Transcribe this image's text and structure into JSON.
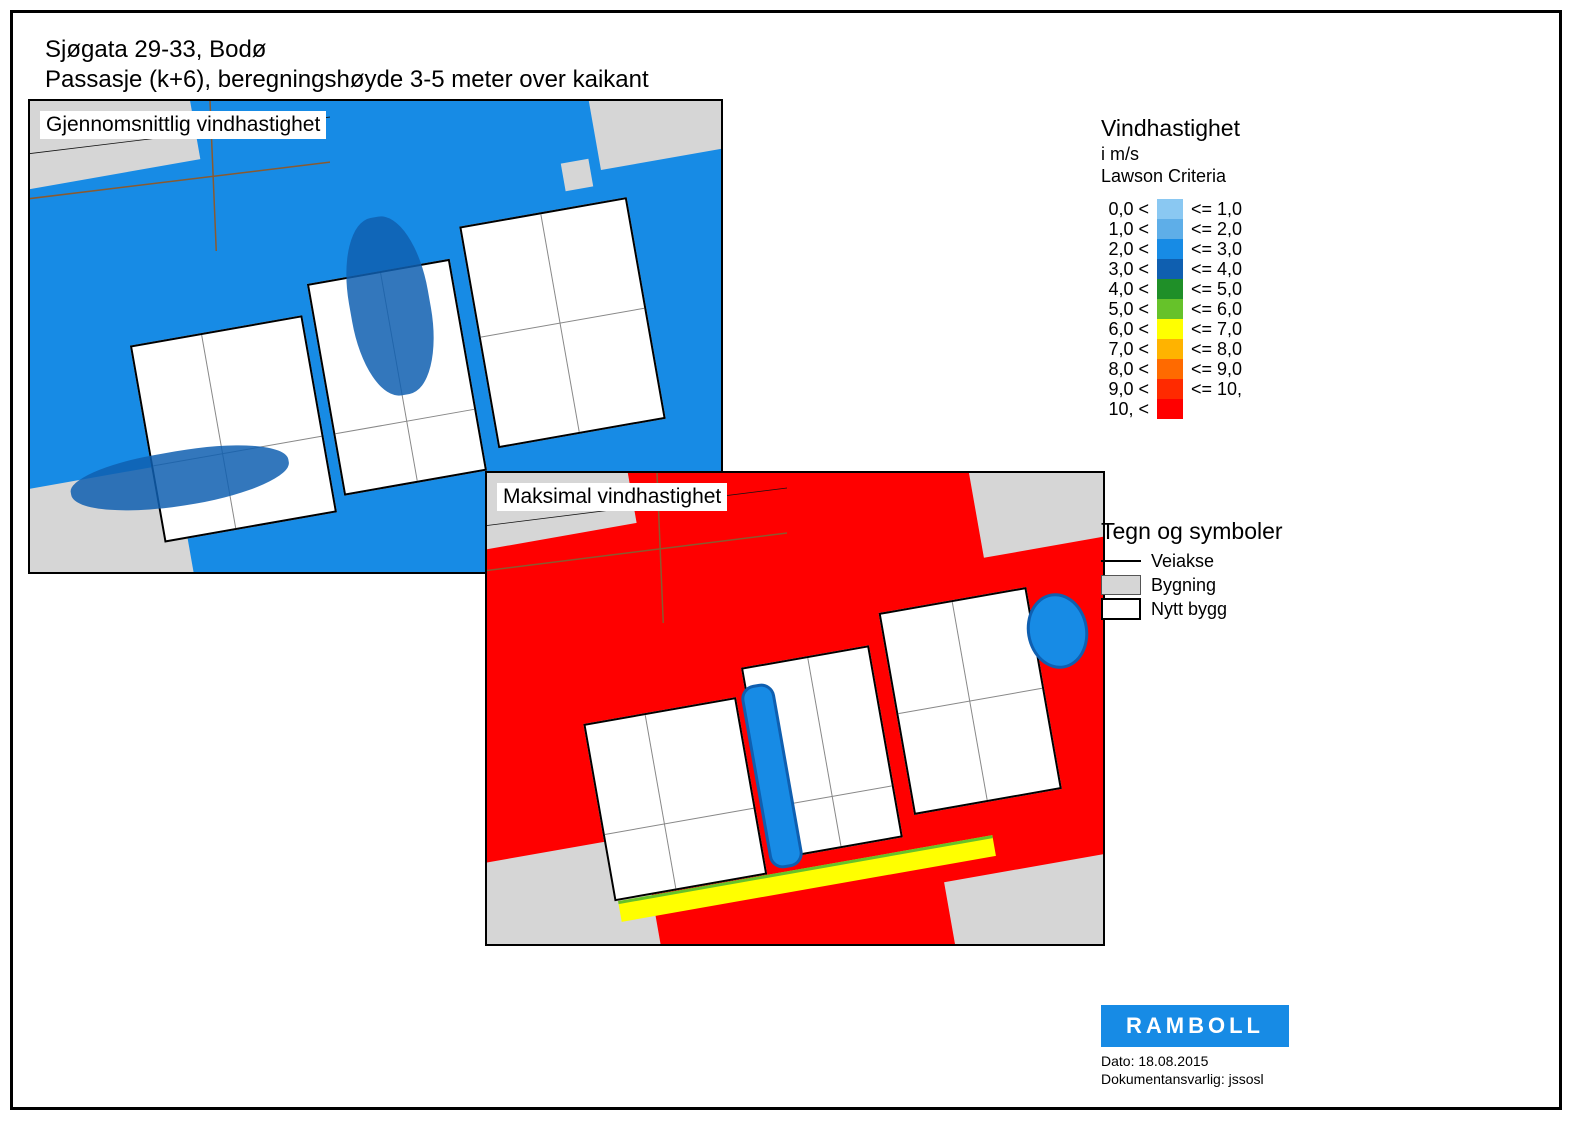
{
  "title": {
    "line1": "Sjøgata 29-33, Bodø",
    "line2": "Passasje (k+6), beregningshøyde 3-5 meter over kaikant"
  },
  "panels": {
    "avg_label": "Gjennomsnittlig vindhastighet",
    "max_label": "Maksimal vindhastighet"
  },
  "legend": {
    "title": "Vindhastighet",
    "subtitle": "i m/s\nLawson Criteria",
    "rows": [
      {
        "low": "0,0 <",
        "color": "#8ac8f2",
        "high": "<= 1,0"
      },
      {
        "low": "1,0 <",
        "color": "#5eaee8",
        "high": "<= 2,0"
      },
      {
        "low": "2,0 <",
        "color": "#178be5",
        "high": "<= 3,0"
      },
      {
        "low": "3,0 <",
        "color": "#0f5fb0",
        "high": "<= 4,0"
      },
      {
        "low": "4,0 <",
        "color": "#1f8f28",
        "high": "<= 5,0"
      },
      {
        "low": "5,0 <",
        "color": "#66c22a",
        "high": "<= 6,0"
      },
      {
        "low": "6,0 <",
        "color": "#ffff00",
        "high": "<= 7,0"
      },
      {
        "low": "7,0 <",
        "color": "#ffb300",
        "high": "<= 8,0"
      },
      {
        "low": "8,0 <",
        "color": "#ff6a00",
        "high": "<= 9,0"
      },
      {
        "low": "9,0 <",
        "color": "#ff2a00",
        "high": "<= 10,"
      },
      {
        "low": "10, <",
        "color": "#ff0000",
        "high": ""
      }
    ]
  },
  "symbols": {
    "title": "Tegn og symboler",
    "items": [
      {
        "kind": "line",
        "label": "Veiakse"
      },
      {
        "kind": "grey",
        "label": "Bygning"
      },
      {
        "kind": "white",
        "label": "Nytt bygg"
      }
    ]
  },
  "logo_text": "RAMBOLL",
  "meta": {
    "date_label": "Dato: ",
    "date_value": "18.08.2015",
    "owner_label": "Dokumentansvarlig: ",
    "owner_value": "jssosl"
  }
}
